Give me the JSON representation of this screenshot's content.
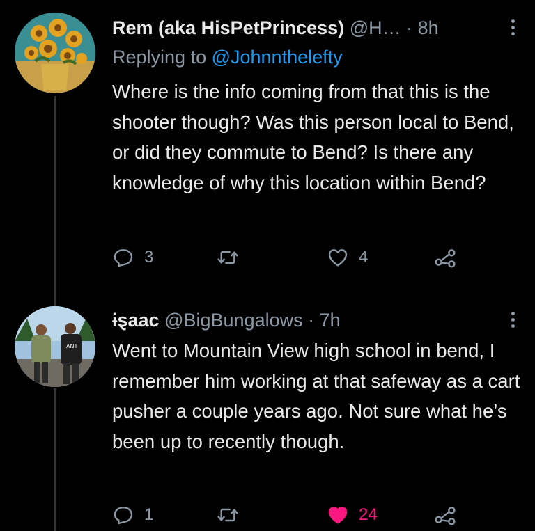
{
  "tweets": [
    {
      "name": "Rem (aka HisPetPrincess)",
      "handle": "@H…",
      "separator": "·",
      "time": "8h",
      "replying_prefix": "Replying to ",
      "replying_to": "@Johnnthelefty",
      "text": "Where is the info coming from that this is the shooter though? Was this person local to Bend, or did they commute to Bend? Is there any knowledge of why this location within Bend?",
      "replies": "3",
      "retweets": "",
      "likes": "4",
      "liked": false,
      "avatar_icon": "sunflowers-painting-avatar"
    },
    {
      "name": "ɨȿaac",
      "handle": "@BigBungalows",
      "separator": "·",
      "time": "7h",
      "text": "Went to Mountain View high school in bend, I remember him working at that safeway as a cart pusher a couple years ago. Not sure what he’s been up to recently though.",
      "replies": "1",
      "retweets": "",
      "likes": "24",
      "liked": true,
      "avatar_icon": "two-people-photo-avatar"
    }
  ],
  "colors": {
    "background": "#000000",
    "text": "#e7e9ea",
    "secondary": "#8b98a5",
    "link": "#1d9bf0",
    "like_active": "#f91880"
  },
  "icons": [
    "reply-icon",
    "retweet-icon",
    "like-icon",
    "share-icon",
    "more-icon"
  ]
}
